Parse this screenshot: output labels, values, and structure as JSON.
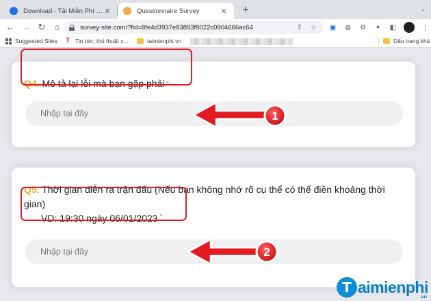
{
  "browser": {
    "tabs": [
      {
        "title": "Download - Tải Miễn Phí VN - Pi",
        "active": false
      },
      {
        "title": "Questionnaire Survey",
        "active": true
      }
    ],
    "new_tab": "+",
    "close_glyph": "✕",
    "address": "survey-site.com/?fid=8fe4d3937e83893f9022c0904666ac64",
    "bookmarks": [
      {
        "label": "Suggested Sites"
      },
      {
        "label": "Tin tức, thủ thuật c..."
      },
      {
        "label": "taimienphi.vn"
      },
      {
        "label": "Dấu trang khá"
      }
    ]
  },
  "questions": [
    {
      "number": "Q4.",
      "text": "Mô tả lại lỗi mà bạn gặp phải",
      "required_mark": "*",
      "placeholder": "Nhập tại đây"
    },
    {
      "number": "Q5.",
      "text": "Thời gian diễn ra trận đấu (Nếu bạn không nhớ rõ cụ thể có thể điền khoảng thời gian)",
      "example": "VD: 19:30 ngày 06/01/2023",
      "required_mark": "*",
      "placeholder": "Nhập tại đây"
    }
  ],
  "annotations": [
    {
      "label": "1",
      "color": "#e11b22"
    },
    {
      "label": "2",
      "color": "#e11b22"
    }
  ],
  "watermark": {
    "text": "aimienphi",
    "initial": "T",
    "suffix": ".vn"
  }
}
